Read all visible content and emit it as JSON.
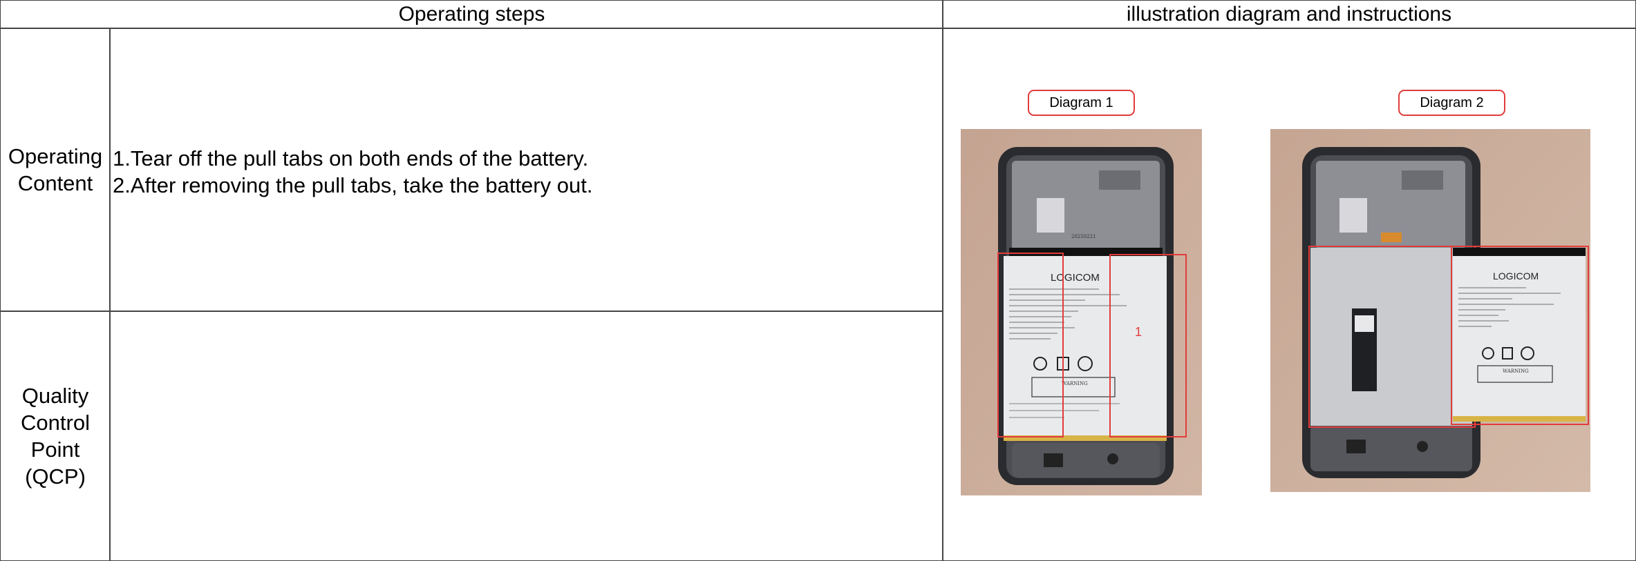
{
  "table": {
    "header_steps": "Operating steps",
    "header_illustration": "illustration diagram and instructions",
    "row1_label_line1": "Operating",
    "row1_label_line2": "Content",
    "steps": [
      "1.Tear off the pull tabs on both ends of the battery.",
      "2.After removing the pull tabs, take the battery out."
    ],
    "row2_label_line1": "Quality",
    "row2_label_line2": "Control",
    "row2_label_line3": "Point",
    "row2_label_line4": "(QCP)",
    "qcp_content": ""
  },
  "diagrams": [
    {
      "label": "Diagram 1",
      "battery_brand": "LOGICOM",
      "frame_code": "20250221",
      "tab_marker": "1",
      "warning": "WARNING"
    },
    {
      "label": "Diagram 2",
      "battery_brand": "LOGICOM",
      "warning": "WARNING"
    }
  ],
  "colors": {
    "highlight_box": "#e23b3b",
    "grid_line": "#444444",
    "desk": "#c9ab97",
    "phone_frame": "#2a2b2e"
  }
}
